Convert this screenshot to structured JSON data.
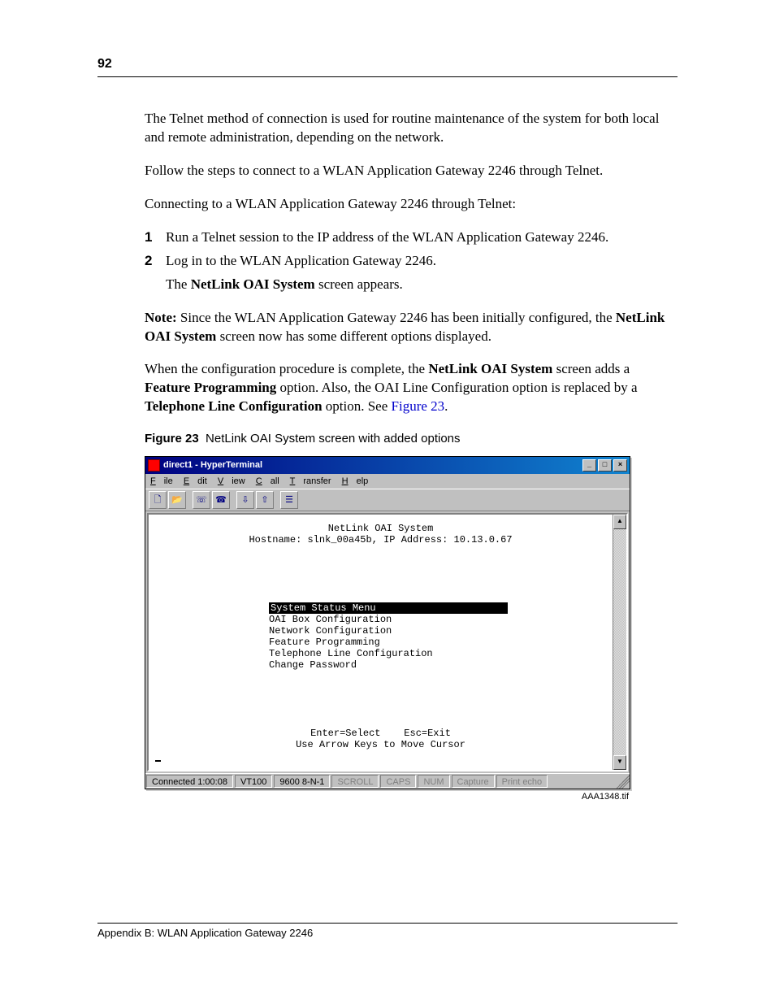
{
  "page_number": "92",
  "para1": "The Telnet method of connection is used for routine maintenance of the system for both local and remote administration, depending on the network.",
  "para2": "Follow the steps to connect to a WLAN Application Gateway 2246 through Telnet.",
  "para3": "Connecting to a WLAN Application Gateway 2246 through Telnet:",
  "steps": [
    {
      "num": "1",
      "text": "Run a Telnet session to the IP address of the WLAN Application Gateway 2246."
    },
    {
      "num": "2",
      "text": "Log in to the WLAN Application Gateway 2246."
    }
  ],
  "step2_sub_pre": "The ",
  "step2_sub_bold": "NetLink OAI System",
  "step2_sub_post": " screen appears.",
  "note_label": "Note:",
  "note_text1": " Since the WLAN Application Gateway 2246 has been initially configured, the ",
  "note_bold": "NetLink OAI System",
  "note_text2": " screen now has some different options displayed.",
  "para5_a": "When the configuration procedure is complete, the ",
  "para5_b1": "NetLink OAI System",
  "para5_c": " screen adds a ",
  "para5_b2": "Feature Programming",
  "para5_d": " option. Also, the OAI Line Configuration option is replaced by a ",
  "para5_b3": "Telephone Line Configuration",
  "para5_e": " option. See ",
  "para5_link": "Figure 23",
  "para5_f": ".",
  "fig_label": "Figure 23",
  "fig_caption": "NetLink OAI System screen with added options",
  "win": {
    "title": "direct1 - HyperTerminal",
    "menus": {
      "file": "File",
      "edit": "Edit",
      "view": "View",
      "call": "Call",
      "transfer": "Transfer",
      "help": "Help"
    },
    "terminal": {
      "title": "NetLink OAI System",
      "hostline": "Hostname: slnk_00a45b, IP Address: 10.13.0.67",
      "menu_sel": "System Status Menu",
      "menu": [
        "OAI Box Configuration",
        "Network Configuration",
        "Feature Programming",
        "Telephone Line Configuration",
        "Change Password"
      ],
      "hint1": "Enter=Select    Esc=Exit",
      "hint2": "Use Arrow Keys to Move Cursor"
    },
    "status": {
      "connected": "Connected 1:00:08",
      "emul": "VT100",
      "baud": "9600 8-N-1",
      "scroll": "SCROLL",
      "caps": "CAPS",
      "num": "NUM",
      "capture": "Capture",
      "echo": "Print echo"
    }
  },
  "img_label": "AAA1348.tif",
  "footer": "Appendix B: WLAN Application Gateway 2246"
}
